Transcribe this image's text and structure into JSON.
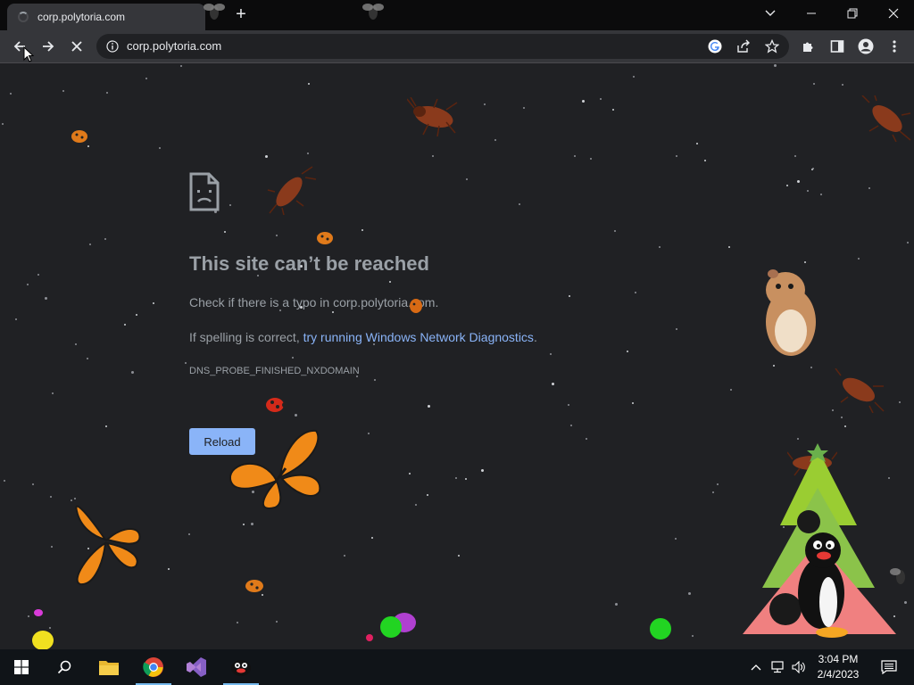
{
  "browser": {
    "tab_title": "corp.polytoria.com",
    "url": "corp.polytoria.com"
  },
  "error_page": {
    "title": "This site can’t be reached",
    "line1": "Check if there is a typo in corp.polytoria.com.",
    "line2_prefix": "If spelling is correct, ",
    "line2_link": "try running Windows Network Diagnostics",
    "line2_suffix": ".",
    "error_code": "DNS_PROBE_FINISHED_NXDOMAIN",
    "reload_label": "Reload"
  },
  "taskbar": {
    "time": "3:04 PM",
    "date": "2/4/2023",
    "items": [
      "start-button",
      "search-icon",
      "file-explorer-icon",
      "chrome-icon",
      "visual-studio-icon",
      "penguin-app-icon"
    ]
  },
  "colors": {
    "page_bg": "#202124",
    "link": "#8ab4f8",
    "reload_button": "#8ab4f8",
    "text": "#9aa0a6"
  }
}
